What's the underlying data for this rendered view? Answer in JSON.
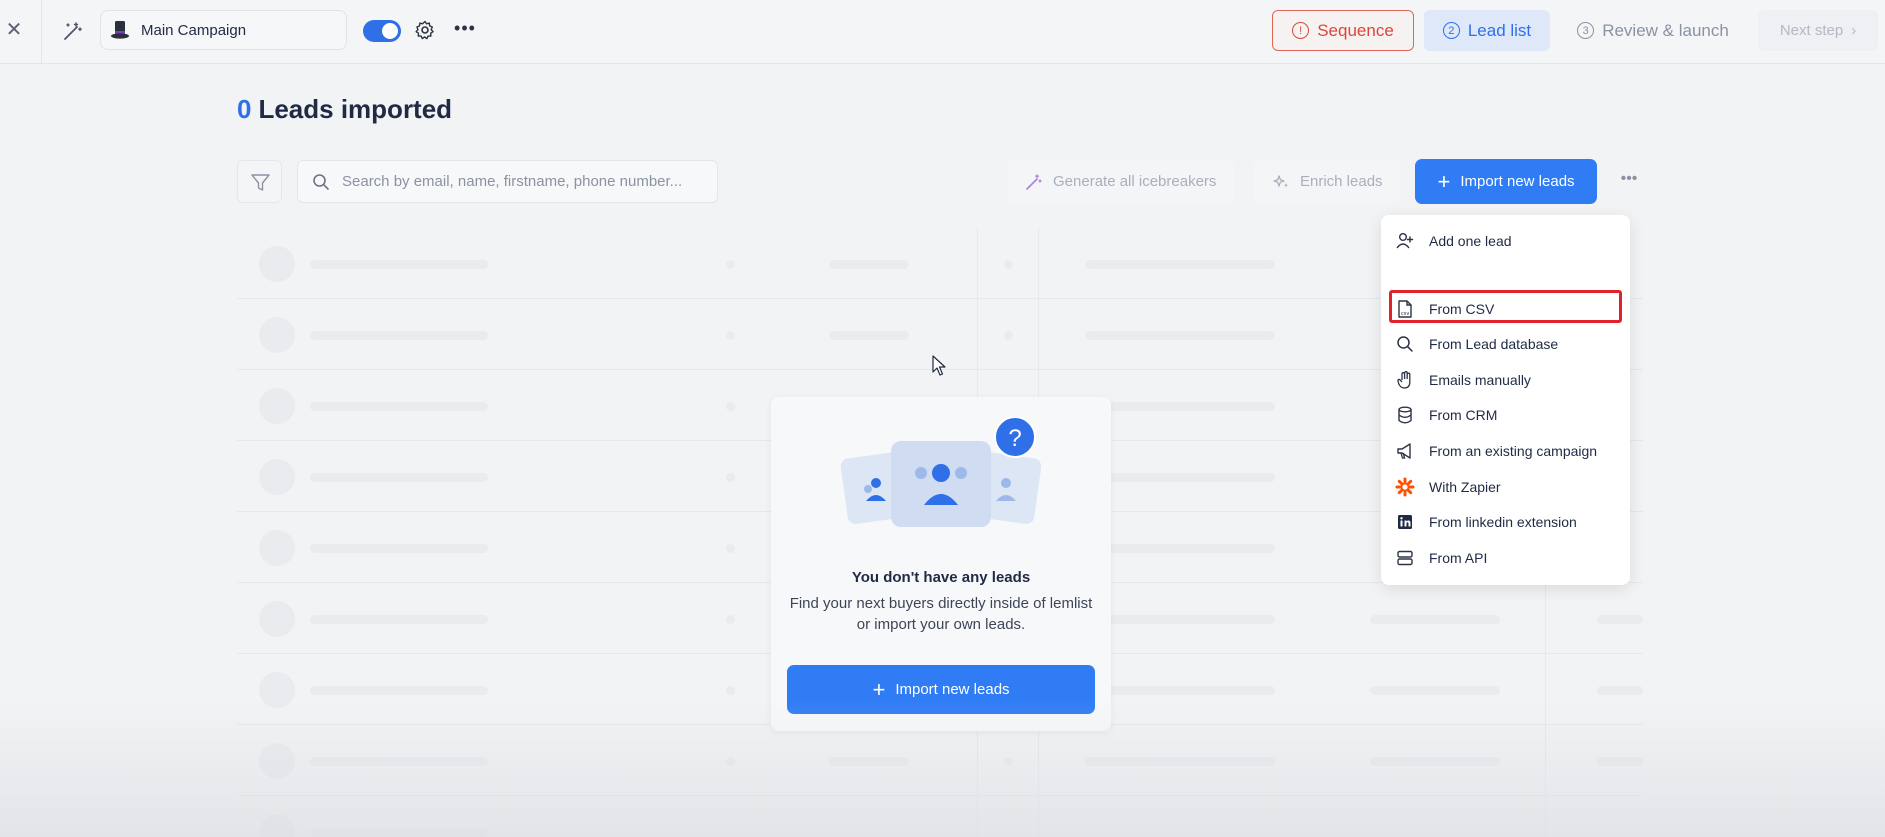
{
  "topbar": {
    "campaign_name": "Main Campaign",
    "steps": [
      {
        "num": "!",
        "label": "Sequence"
      },
      {
        "num": "2",
        "label": "Lead list"
      },
      {
        "num": "3",
        "label": "Review & launch"
      }
    ],
    "next_label": "Next step"
  },
  "header": {
    "count": "0",
    "title": "Leads imported"
  },
  "toolbar": {
    "search_placeholder": "Search by email, name, firstname, phone number...",
    "generate_label": "Generate all icebreakers",
    "enrich_label": "Enrich leads",
    "import_label": "Import new leads"
  },
  "empty_state": {
    "title": "You don't have any leads",
    "description_line1": "Find your next buyers directly inside of lemlist",
    "description_line2": "or import your own leads.",
    "button_label": "Import new leads",
    "badge": "?"
  },
  "import_menu": {
    "items": [
      {
        "label": "Add one lead",
        "icon": "add-user-icon"
      },
      {
        "label": "From CSV",
        "icon": "csv-file-icon"
      },
      {
        "label": "From Lead database",
        "icon": "search-icon"
      },
      {
        "label": "Emails manually",
        "icon": "hand-icon"
      },
      {
        "label": "From CRM",
        "icon": "database-icon"
      },
      {
        "label": "From an existing campaign",
        "icon": "megaphone-icon"
      },
      {
        "label": "With Zapier",
        "icon": "zapier-icon"
      },
      {
        "label": "From linkedin extension",
        "icon": "linkedin-icon"
      },
      {
        "label": "From API",
        "icon": "server-icon"
      }
    ]
  },
  "colors": {
    "accent": "#2f7cf5",
    "warning": "#d9473a",
    "highlight": "#e2222b"
  }
}
